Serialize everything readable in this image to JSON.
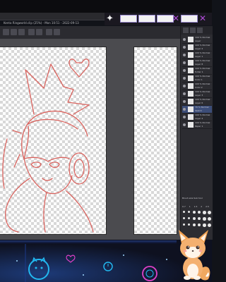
{
  "window": {
    "title_bar_text": "Kenta Ringworld.clip (25%) - Mon 10:51 - 2022-09-13"
  },
  "layers_panel": {
    "selected_index": 9,
    "layers": [
      {
        "name": "100 % Normal\nLayer"
      },
      {
        "name": "100 % Normal\nLayer 2"
      },
      {
        "name": "100 % Normal\nLayer 1"
      },
      {
        "name": "100 % Normal\nLayer 8"
      },
      {
        "name": "100 % Normal\nfolder 1"
      },
      {
        "name": "100 % Normal\nColor 1"
      },
      {
        "name": "100 % Normal\nColor 2"
      },
      {
        "name": "100 % Normal\nLayer 3"
      },
      {
        "name": "100 % Normal\nLayer 6"
      },
      {
        "name": "70 % Normal\nSketch"
      },
      {
        "name": "100 % Normal\nLayer 4"
      },
      {
        "name": "100 % Normal\nPaper 1"
      }
    ]
  },
  "brush_panel": {
    "header": "Brush size  Sub tool",
    "sizes": [
      "0.7",
      "1",
      "1.5",
      "2",
      "2.5"
    ]
  },
  "colors": {
    "sketch_line": "#d9635e",
    "workspace": "#4b4b4f",
    "selected_layer": "#3c4d78",
    "accent_purple": "#b04ad8",
    "neon_blue": "#22b8f0",
    "neon_pink": "#e040c8"
  }
}
